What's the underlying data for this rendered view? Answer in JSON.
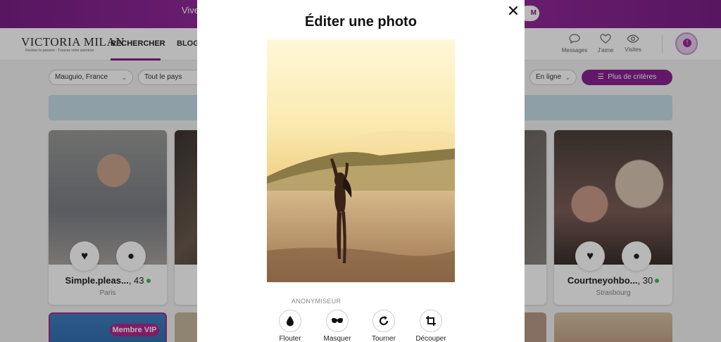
{
  "promo": {
    "text": "Vive",
    "button": "M"
  },
  "nav": {
    "logo": "VICTORIA MILAN",
    "tagline": "Revivez la passion - Trouvez votre aventure",
    "tabs": [
      {
        "label": "RECHERCHER"
      },
      {
        "label": "BLOG"
      }
    ],
    "icons": [
      {
        "icon": "chat-icon",
        "label": "Messages"
      },
      {
        "icon": "heart-icon",
        "label": "J'aime"
      },
      {
        "icon": "eye-icon",
        "label": "Visites"
      }
    ],
    "avatar_badge": "!"
  },
  "filters": {
    "location": "Mauguio, France",
    "country": "Tout le pays",
    "status": "En ligne",
    "more_criteria": "Plus de critères"
  },
  "cards": [
    {
      "name": "Simple.pleas...",
      "age": ", 43",
      "city": "Paris"
    },
    {
      "name": "Courtneyohbo...",
      "age": ", 30",
      "city": "Strasbourg"
    }
  ],
  "vip_badge": "Membre VIP",
  "modal": {
    "title": "Éditer une photo",
    "close_icon": "close-icon",
    "section_label": "ANONYMISEUR",
    "tools": [
      {
        "icon": "drop-icon",
        "label": "Flouter"
      },
      {
        "icon": "mask-icon",
        "label": "Masquer"
      },
      {
        "icon": "rotate-icon",
        "label": "Tourner"
      },
      {
        "icon": "crop-icon",
        "label": "Découper"
      }
    ]
  },
  "colors": {
    "brand_purple": "#8a2090",
    "online_green": "#3cbc53"
  }
}
